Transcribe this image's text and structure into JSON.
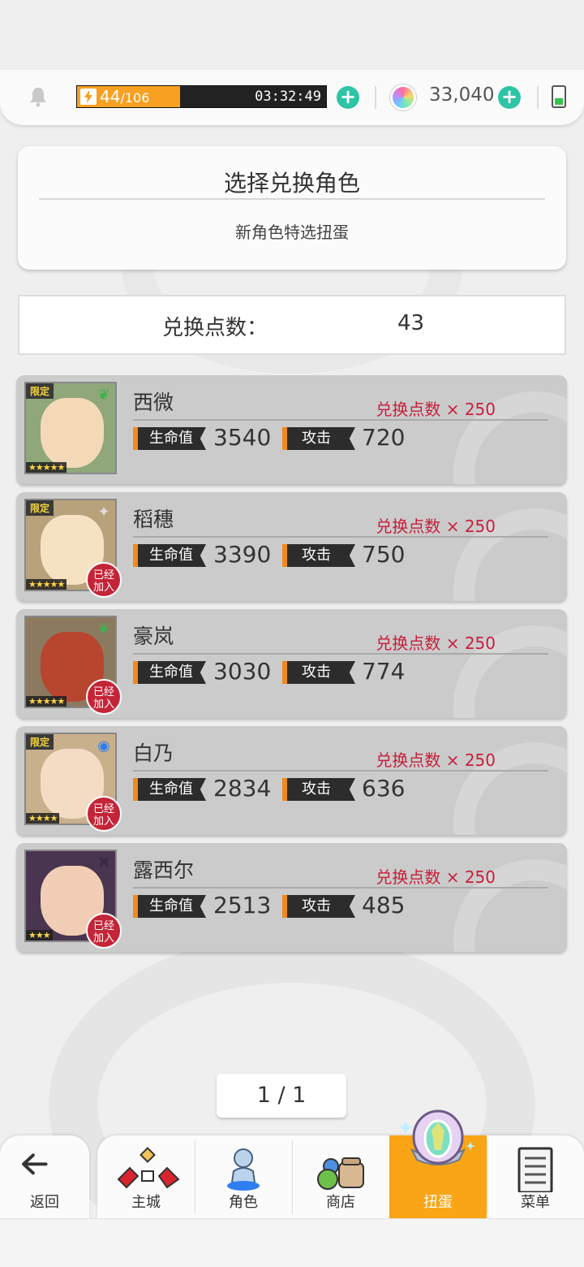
{
  "status_bar": {
    "energy_current": "44",
    "energy_max": "/106",
    "energy_fraction": 0.4151,
    "energy_timer": "03:32:49",
    "gems": "33,040"
  },
  "header": {
    "title": "选择兑换角色",
    "subtitle": "新角色特选扭蛋"
  },
  "points": {
    "label": "兑换点数：",
    "value": "43"
  },
  "stat_labels": {
    "hp": "生命值",
    "atk": "攻击"
  },
  "characters": [
    {
      "name": "西微",
      "hp": "3540",
      "atk": "720",
      "cost": "兑换点数 × 250",
      "limited": "限定",
      "stars": "★★★★★",
      "joined": "",
      "element": "leaf-icon",
      "element_color": "#3fb24a",
      "portrait_bg": "#8fa77a",
      "face": "#f3d9b6"
    },
    {
      "name": "稻穗",
      "hp": "3390",
      "atk": "750",
      "cost": "兑换点数 × 250",
      "limited": "限定",
      "stars": "★★★★★",
      "joined": "已经\n加入",
      "element": "sparkle-icon",
      "element_color": "#dcdcdc",
      "portrait_bg": "#b8a27c",
      "face": "#f6e2c2"
    },
    {
      "name": "豪岚",
      "hp": "3030",
      "atk": "774",
      "cost": "兑换点数 × 250",
      "limited": "",
      "stars": "★★★★★",
      "joined": "已经\n加入",
      "element": "leaf-icon",
      "element_color": "#3fb24a",
      "portrait_bg": "#8c7a60",
      "face": "#b8452e"
    },
    {
      "name": "白乃",
      "hp": "2834",
      "atk": "636",
      "cost": "兑换点数 × 250",
      "limited": "限定",
      "stars": "★★★★",
      "joined": "已经\n加入",
      "element": "water-orb-icon",
      "element_color": "#2f7ef0",
      "portrait_bg": "#c9b08d",
      "face": "#f4dcc4"
    },
    {
      "name": "露西尔",
      "hp": "2513",
      "atk": "485",
      "cost": "兑换点数 × 250",
      "limited": "",
      "stars": "★★★",
      "joined": "已经\n加入",
      "element": "dark-star-icon",
      "element_color": "#3a2a4a",
      "portrait_bg": "#4a3550",
      "face": "#f0cdb4"
    }
  ],
  "pager": "1 / 1",
  "nav": {
    "back": "返回",
    "items": [
      {
        "label": "主城",
        "icon": "castle-icon"
      },
      {
        "label": "角色",
        "icon": "character-icon"
      },
      {
        "label": "商店",
        "icon": "shop-icon"
      },
      {
        "label": "扭蛋",
        "icon": "gacha-icon"
      },
      {
        "label": "菜单",
        "icon": "menu-list-icon"
      }
    ],
    "active": "扭蛋"
  },
  "colors": {
    "accent_orange": "#f9a516",
    "cost_red": "#c6203a",
    "plus_teal": "#2ec4a6",
    "joined_red": "#c42437"
  }
}
